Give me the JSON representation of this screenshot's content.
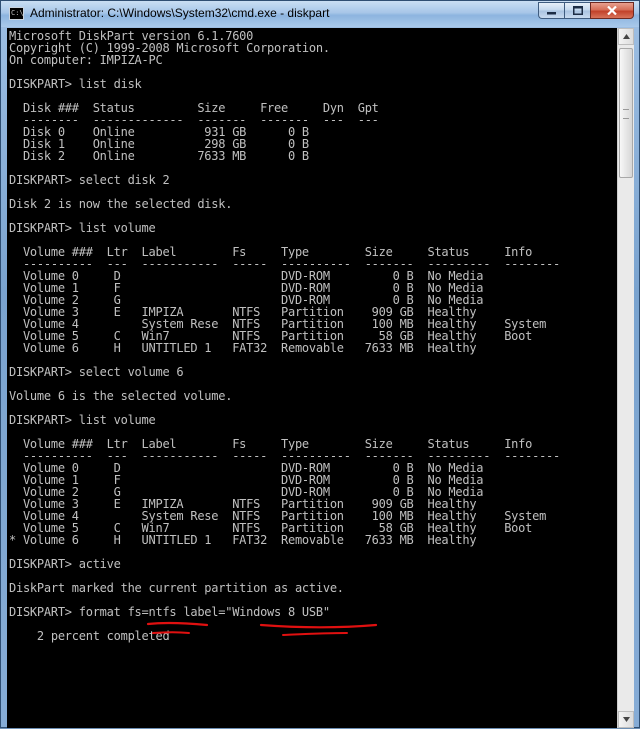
{
  "window": {
    "title": "Administrator: C:\\Windows\\System32\\cmd.exe - diskpart",
    "icon_label": "C:\\",
    "minimize_icon": "minimize-icon",
    "maximize_icon": "maximize-icon",
    "close_icon": "close-icon"
  },
  "console": {
    "background_color": "#000000",
    "text_color": "#c0c0c0",
    "lines": [
      "Microsoft DiskPart version 6.1.7600",
      "Copyright (C) 1999-2008 Microsoft Corporation.",
      "On computer: IMPIZA-PC",
      "",
      "DISKPART> list disk",
      "",
      "  Disk ###  Status         Size     Free     Dyn  Gpt",
      "  --------  -------------  -------  -------  ---  ---",
      "  Disk 0    Online          931 GB      0 B",
      "  Disk 1    Online          298 GB      0 B",
      "  Disk 2    Online         7633 MB      0 B",
      "",
      "DISKPART> select disk 2",
      "",
      "Disk 2 is now the selected disk.",
      "",
      "DISKPART> list volume",
      "",
      "  Volume ###  Ltr  Label        Fs     Type        Size     Status     Info",
      "  ----------  ---  -----------  -----  ----------  -------  ---------  --------",
      "  Volume 0     D                       DVD-ROM         0 B  No Media",
      "  Volume 1     F                       DVD-ROM         0 B  No Media",
      "  Volume 2     G                       DVD-ROM         0 B  No Media",
      "  Volume 3     E   IMPIZA       NTFS   Partition    909 GB  Healthy",
      "  Volume 4         System Rese  NTFS   Partition    100 MB  Healthy    System",
      "  Volume 5     C   Win7         NTFS   Partition     58 GB  Healthy    Boot",
      "  Volume 6     H   UNTITLED 1   FAT32  Removable   7633 MB  Healthy",
      "",
      "DISKPART> select volume 6",
      "",
      "Volume 6 is the selected volume.",
      "",
      "DISKPART> list volume",
      "",
      "  Volume ###  Ltr  Label        Fs     Type        Size     Status     Info",
      "  ----------  ---  -----------  -----  ----------  -------  ---------  --------",
      "  Volume 0     D                       DVD-ROM         0 B  No Media",
      "  Volume 1     F                       DVD-ROM         0 B  No Media",
      "  Volume 2     G                       DVD-ROM         0 B  No Media",
      "  Volume 3     E   IMPIZA       NTFS   Partition    909 GB  Healthy",
      "  Volume 4         System Rese  NTFS   Partition    100 MB  Healthy    System",
      "  Volume 5     C   Win7         NTFS   Partition     58 GB  Healthy    Boot",
      "* Volume 6     H   UNTITLED 1   FAT32  Removable   7633 MB  Healthy",
      "",
      "DISKPART> active",
      "",
      "DiskPart marked the current partition as active.",
      "",
      "DISKPART> format fs=ntfs label=\"Windows 8 USB\"",
      "",
      "    2 percent completed"
    ]
  },
  "annotation": {
    "color": "#e01010"
  },
  "scrollbar": {
    "up_icon": "scroll-up-arrow-icon",
    "down_icon": "scroll-down-arrow-icon"
  }
}
